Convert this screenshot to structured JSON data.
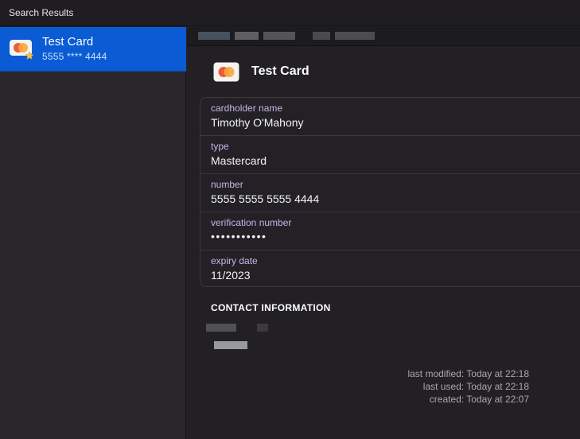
{
  "topbar": {
    "title": "Search Results"
  },
  "sidebar": {
    "results": [
      {
        "title": "Test Card",
        "subtitle": "5555 **** 4444",
        "icon": "credit-card-icon",
        "selected": true
      }
    ]
  },
  "detail": {
    "title": "Test Card",
    "icon": "mastercard-icon",
    "fields": [
      {
        "label": "cardholder name",
        "value": "Timothy O'Mahony"
      },
      {
        "label": "type",
        "value": "Mastercard"
      },
      {
        "label": "number",
        "value": "5555 5555 5555 4444"
      },
      {
        "label": "verification number",
        "value": "•••••••••••"
      },
      {
        "label": "expiry date",
        "value": "11/2023"
      }
    ],
    "section_title": "CONTACT INFORMATION",
    "meta": {
      "last_modified": "last modified: Today at 22:18",
      "last_used": "last used: Today at 22:18",
      "created": "created: Today at 22:07"
    }
  },
  "colors": {
    "selection": "#0a5bd4",
    "label": "#c8b4e6",
    "background": "#222024",
    "mastercard_red": "#eb5a3c",
    "mastercard_orange": "#f7a63b"
  }
}
